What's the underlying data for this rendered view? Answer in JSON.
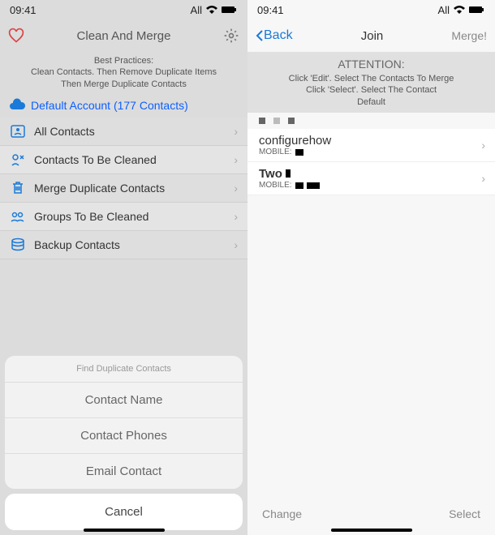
{
  "left": {
    "status": {
      "time": "09:41",
      "carrier": "All"
    },
    "nav": {
      "title": "Clean And Merge"
    },
    "info": {
      "line1": "Best Practices:",
      "line2": "Clean Contacts. Then Remove Duplicate Items",
      "line3": "Then Merge Duplicate Contacts"
    },
    "account": "Default Account (177 Contacts)",
    "menu": [
      "All Contacts",
      "Contacts To Be Cleaned",
      "Merge Duplicate Contacts",
      "Groups To Be Cleaned",
      "Backup Contacts"
    ],
    "sheet": {
      "header": "Find Duplicate Contacts",
      "options": [
        "Contact Name",
        "Contact Phones",
        "Email Contact"
      ],
      "cancel": "Cancel"
    }
  },
  "right": {
    "status": {
      "time": "09:41",
      "carrier": "All"
    },
    "nav": {
      "back": "Back",
      "title": "Join",
      "action": "Merge!"
    },
    "info": {
      "line1": "ATTENTION:",
      "line2": "Click 'Edit'. Select The Contacts To Merge",
      "line3": "Click 'Select'. Select The Contact",
      "line4": "Default"
    },
    "contacts": [
      {
        "name": "configurehow",
        "mobile_label": "MOBILE:"
      },
      {
        "name": "Two",
        "mobile_label": "MOBILE:"
      }
    ],
    "toolbar": {
      "left": "Change",
      "right": "Select"
    }
  }
}
